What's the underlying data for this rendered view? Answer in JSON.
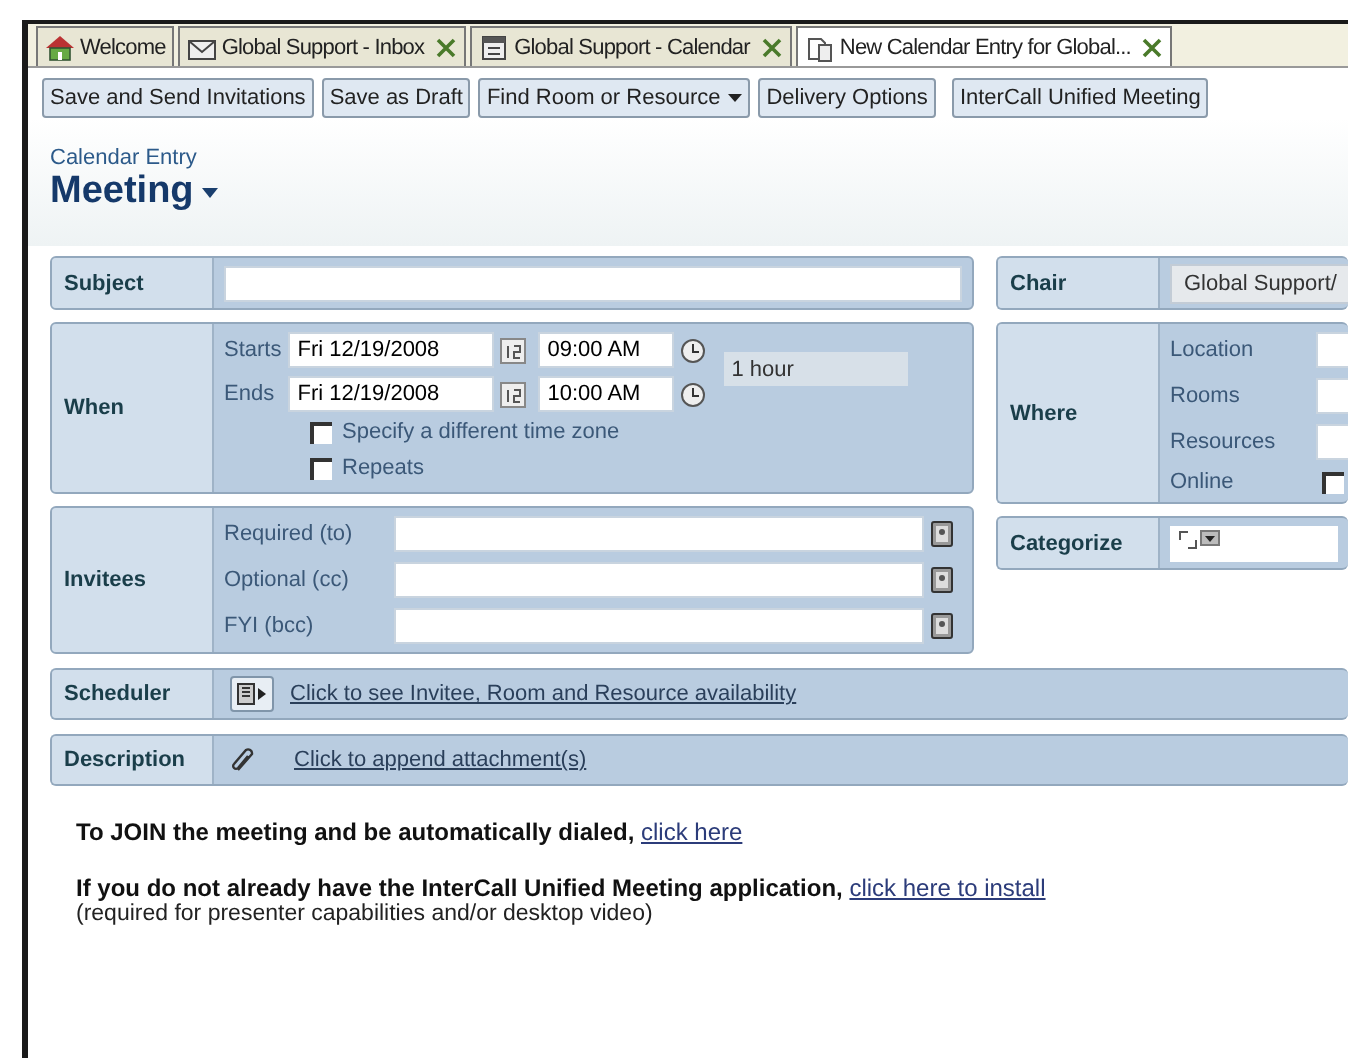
{
  "tabs": [
    {
      "label": "Welcome",
      "kind": "home",
      "closable": false,
      "selected": false
    },
    {
      "label": "Global Support - Inbox",
      "kind": "mail",
      "closable": true,
      "selected": false
    },
    {
      "label": "Global Support - Calendar",
      "kind": "calendar",
      "closable": true,
      "selected": false
    },
    {
      "label": "New Calendar Entry for Global...",
      "kind": "document",
      "closable": true,
      "selected": true
    }
  ],
  "toolbar": [
    {
      "label": "Save and Send Invitations",
      "dropdown": false
    },
    {
      "label": "Save as Draft",
      "dropdown": false
    },
    {
      "label": "Find Room or Resource",
      "dropdown": true
    },
    {
      "label": "Delivery Options",
      "dropdown": false
    },
    {
      "label": "InterCall Unified Meeting",
      "dropdown": false
    }
  ],
  "header": {
    "caption": "Calendar Entry",
    "title": "Meeting"
  },
  "subject": {
    "label": "Subject"
  },
  "when": {
    "label": "When",
    "starts": {
      "label": "Starts",
      "date": "Fri 12/19/2008",
      "time": "09:00 AM"
    },
    "ends": {
      "label": "Ends",
      "date": "Fri 12/19/2008",
      "time": "10:00 AM"
    },
    "duration": "1 hour",
    "options": [
      {
        "label": "Specify a different time zone",
        "checked": false
      },
      {
        "label": "Repeats",
        "checked": false
      }
    ]
  },
  "chair": {
    "label": "Chair",
    "value": "Global Support/"
  },
  "where": {
    "label": "Where",
    "fields": [
      {
        "label": "Location"
      },
      {
        "label": "Rooms"
      },
      {
        "label": "Resources"
      }
    ],
    "online": {
      "label": "Online",
      "checked": false
    }
  },
  "invitees": {
    "label": "Invitees",
    "fields": [
      {
        "label": "Required (to)"
      },
      {
        "label": "Optional (cc)"
      },
      {
        "label": "FYI (bcc)"
      }
    ]
  },
  "categorize": {
    "label": "Categorize"
  },
  "scheduler": {
    "label": "Scheduler",
    "link": "Click to see Invitee, Room and Resource availability"
  },
  "description": {
    "label": "Description",
    "link": "Click to append attachment(s)"
  },
  "body": [
    {
      "text": "To JOIN the meeting and be automatically dialed,",
      "link": "click here"
    },
    {
      "text": "If you do not already have the InterCall Unified Meeting application,",
      "link": "click here to install",
      "note": "(required for presenter capabilities and/or desktop video)"
    }
  ]
}
